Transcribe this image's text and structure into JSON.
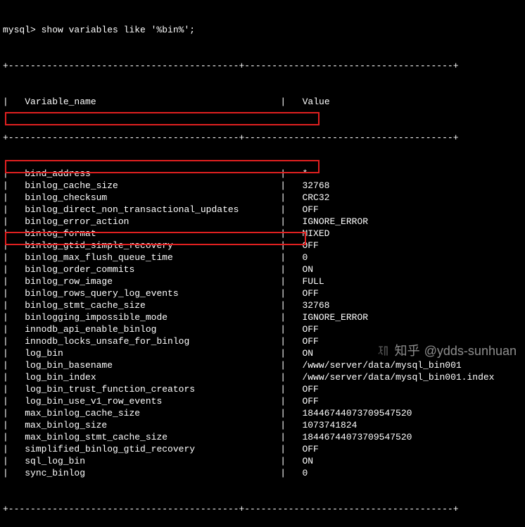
{
  "prompt": "mysql> show variables like '%bin%';",
  "divider": "+------------------------------------------+--------------------------------------+",
  "header": {
    "name": "Variable_name",
    "value": "Value"
  },
  "rows": [
    {
      "name": "bind_address",
      "value": "*"
    },
    {
      "name": "binlog_cache_size",
      "value": "32768"
    },
    {
      "name": "binlog_checksum",
      "value": "CRC32"
    },
    {
      "name": "binlog_direct_non_transactional_updates",
      "value": "OFF"
    },
    {
      "name": "binlog_error_action",
      "value": "IGNORE_ERROR"
    },
    {
      "name": "binlog_format",
      "value": "MIXED"
    },
    {
      "name": "binlog_gtid_simple_recovery",
      "value": "OFF"
    },
    {
      "name": "binlog_max_flush_queue_time",
      "value": "0"
    },
    {
      "name": "binlog_order_commits",
      "value": "ON"
    },
    {
      "name": "binlog_row_image",
      "value": "FULL"
    },
    {
      "name": "binlog_rows_query_log_events",
      "value": "OFF"
    },
    {
      "name": "binlog_stmt_cache_size",
      "value": "32768"
    },
    {
      "name": "binlogging_impossible_mode",
      "value": "IGNORE_ERROR"
    },
    {
      "name": "innodb_api_enable_binlog",
      "value": "OFF"
    },
    {
      "name": "innodb_locks_unsafe_for_binlog",
      "value": "OFF"
    },
    {
      "name": "log_bin",
      "value": "ON"
    },
    {
      "name": "log_bin_basename",
      "value": "/www/server/data/mysql_bin001"
    },
    {
      "name": "log_bin_index",
      "value": "/www/server/data/mysql_bin001.index"
    },
    {
      "name": "log_bin_trust_function_creators",
      "value": "OFF"
    },
    {
      "name": "log_bin_use_v1_row_events",
      "value": "OFF"
    },
    {
      "name": "max_binlog_cache_size",
      "value": "18446744073709547520"
    },
    {
      "name": "max_binlog_size",
      "value": "1073741824"
    },
    {
      "name": "max_binlog_stmt_cache_size",
      "value": "18446744073709547520"
    },
    {
      "name": "simplified_binlog_gtid_recovery",
      "value": "OFF"
    },
    {
      "name": "sql_log_bin",
      "value": "ON"
    },
    {
      "name": "sync_binlog",
      "value": "0"
    }
  ],
  "highlights": [
    {
      "row": "binlog_format"
    },
    {
      "row": "binlog_row_image"
    },
    {
      "row": "log_bin"
    }
  ],
  "watermark": {
    "site": "知乎",
    "author": "@ydds-sunhuan"
  }
}
